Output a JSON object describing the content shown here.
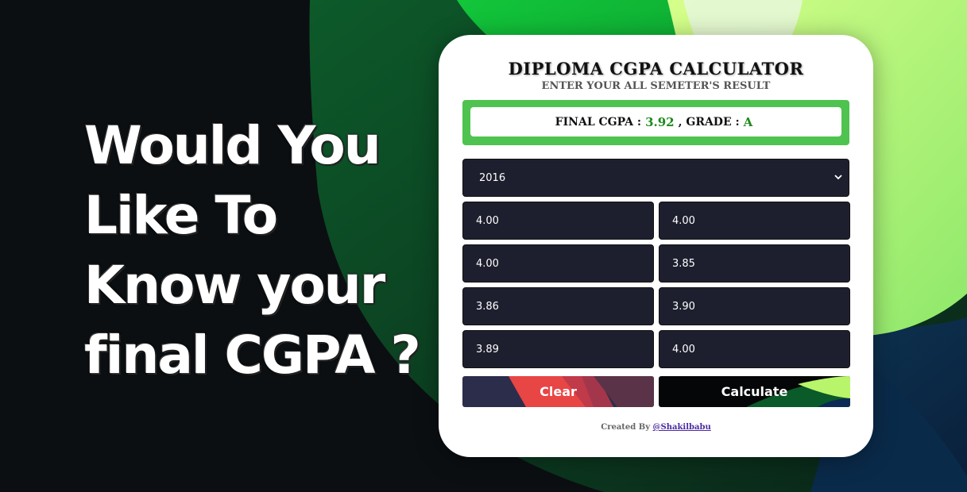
{
  "hero": {
    "line1": "Would You",
    "line2": "Like To",
    "line3": "Know your",
    "line4": "final CGPA ?"
  },
  "calculator": {
    "title": "DIPLOMA CGPA CALCULATOR",
    "subtitle": "ENTER YOUR ALL SEMETER'S RESULT",
    "result": {
      "cgpa_label": "FINAL CGPA :",
      "cgpa_value": "3.92",
      "separator": ", GRADE :",
      "grade_value": "A"
    },
    "regulation_select": {
      "selected": "2016"
    },
    "semesters": [
      "4.00",
      "4.00",
      "4.00",
      "3.85",
      "3.86",
      "3.90",
      "3.89",
      "4.00"
    ],
    "clear_label": "Clear",
    "calculate_label": "Calculate",
    "credit_prefix": "Created By",
    "credit_link": "@Shakilbabu"
  },
  "colors": {
    "result_green": "#4fc34f",
    "value_green": "#1b8a1b",
    "field_bg": "#1e1f2e",
    "clear_accent": "#e84545"
  },
  "icons": {
    "select_arrow": "chevron-down-icon"
  }
}
